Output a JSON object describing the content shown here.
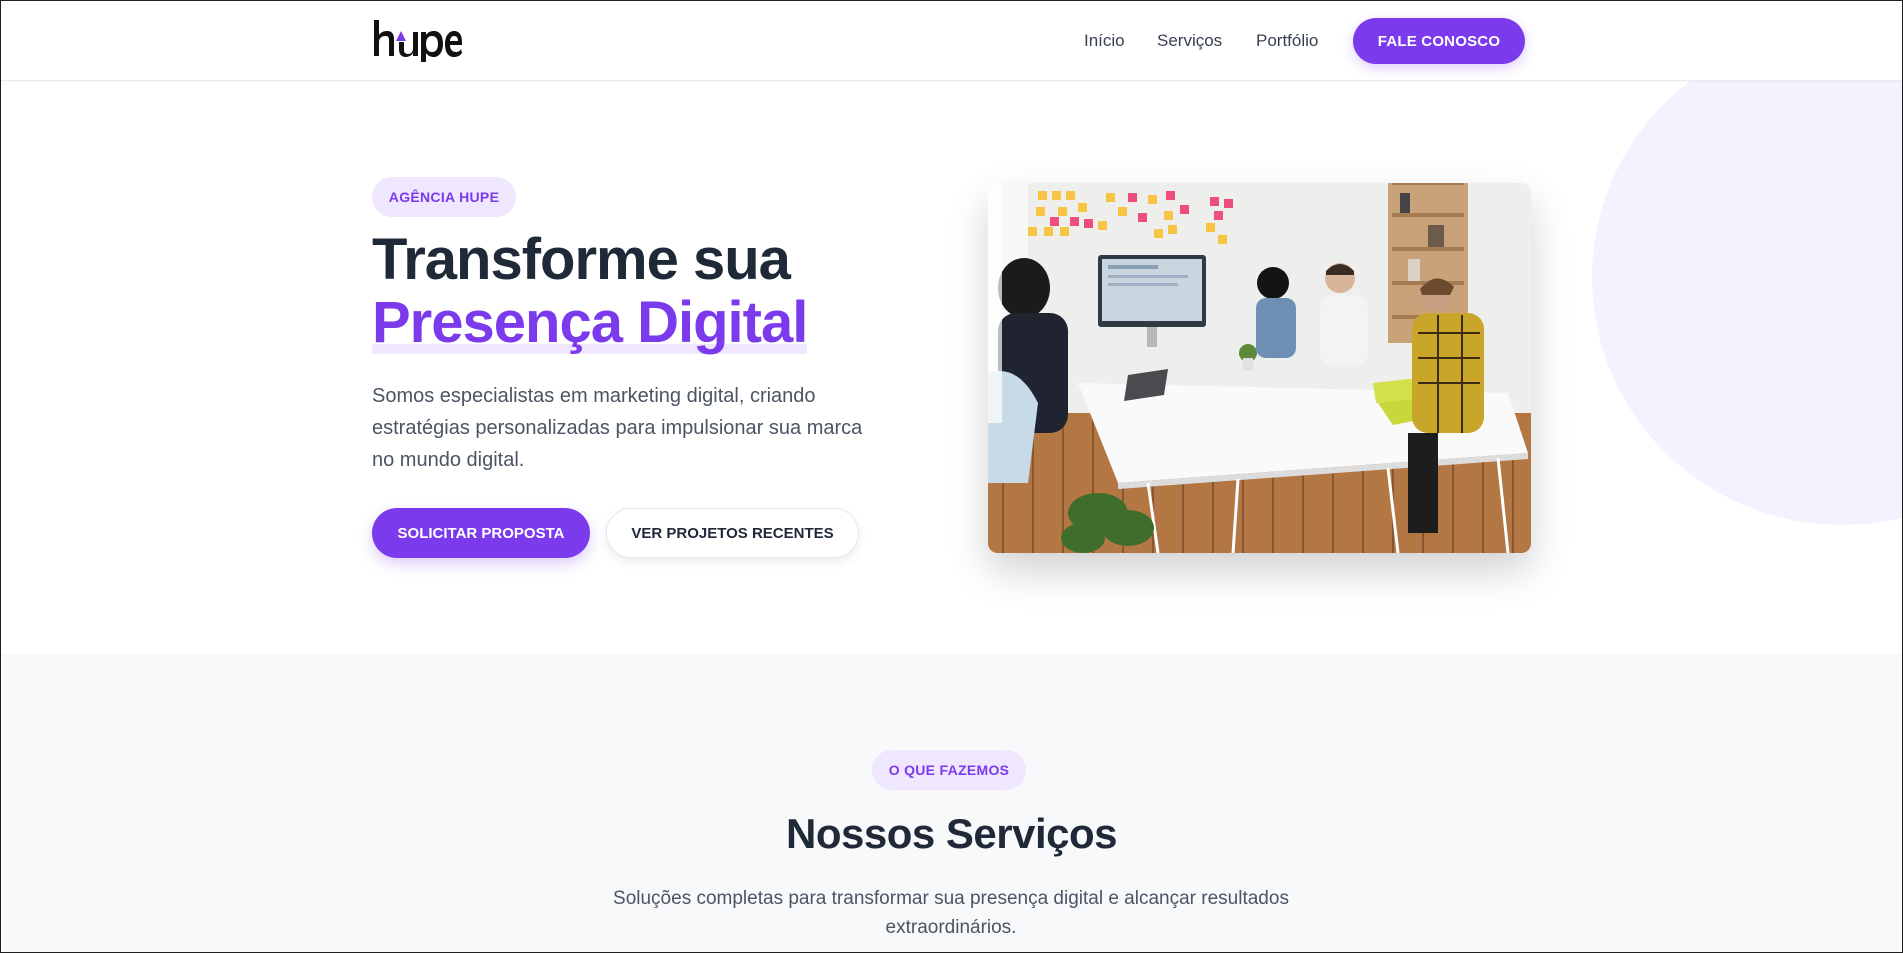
{
  "header": {
    "logo_text": "hupe",
    "nav": [
      {
        "label": "Início"
      },
      {
        "label": "Serviços"
      },
      {
        "label": "Portfólio"
      }
    ],
    "cta_label": "FALE CONOSCO"
  },
  "hero": {
    "badge": "AGÊNCIA HUPE",
    "title_line1": "Transforme sua",
    "title_line2": "Presença Digital",
    "description": "Somos especialistas em marketing digital, criando estratégias personalizadas para impulsionar sua marca no mundo digital.",
    "primary_button": "SOLICITAR PROPOSTA",
    "secondary_button": "VER PROJETOS RECENTES",
    "image_icon": "team-meeting-photo"
  },
  "services": {
    "badge": "O QUE FAZEMOS",
    "title": "Nossos Serviços",
    "description": "Soluções completas para transformar sua presença digital e alcançar resultados extraordinários."
  },
  "colors": {
    "accent": "#7c3aed",
    "accent_soft": "#efe7fd",
    "text_dark": "#1f2937",
    "text_muted": "#4b5563",
    "section_bg": "#f8f9fb"
  }
}
